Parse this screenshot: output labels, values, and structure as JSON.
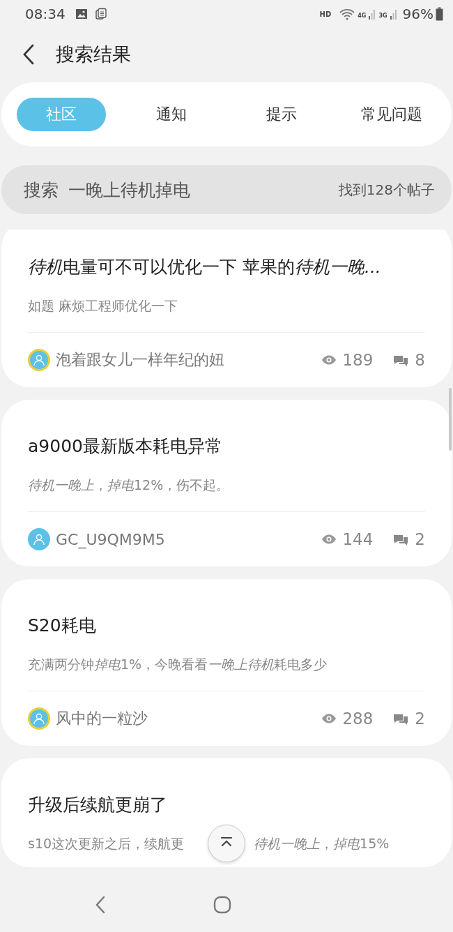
{
  "status_bar": {
    "time": "08:34",
    "network_label": "HD",
    "network_4g": "4G",
    "network_3g": "3G",
    "battery": "96%"
  },
  "header": {
    "title": "搜索结果"
  },
  "tabs": [
    {
      "label": "社区",
      "selected": true
    },
    {
      "label": "通知",
      "selected": false
    },
    {
      "label": "提示",
      "selected": false
    },
    {
      "label": "常见问题",
      "selected": false
    }
  ],
  "search": {
    "label": "搜索",
    "query": "一晚上待机掉电",
    "result_count": "找到128个帖子"
  },
  "posts": [
    {
      "title": [
        {
          "text": "待机",
          "italic": true
        },
        {
          "text": "电量可不可以优化一下 苹果的",
          "italic": false
        },
        {
          "text": "待机一晚...",
          "italic": true
        }
      ],
      "snippet": [
        [
          {
            "text": "如题 麻烦工程师优化一下",
            "italic": false
          }
        ]
      ],
      "author": "泡着跟女儿一样年纪的妞",
      "avatar_ring": true,
      "views": "189",
      "comments": "8"
    },
    {
      "title": [
        {
          "text": "a9000最新版本耗电异常",
          "italic": false
        }
      ],
      "snippet": [
        [
          {
            "text": "待机一晚上",
            "italic": true
          },
          {
            "text": "，",
            "italic": false
          },
          {
            "text": "掉电",
            "italic": true
          },
          {
            "text": "12%，伤不起。",
            "italic": false
          }
        ]
      ],
      "author": "GC_U9QM9M5",
      "avatar_ring": false,
      "views": "144",
      "comments": "2"
    },
    {
      "title": [
        {
          "text": "S20耗电",
          "italic": false
        }
      ],
      "snippet": [
        [
          {
            "text": "充满两分钟",
            "italic": false
          },
          {
            "text": "掉电",
            "italic": true
          },
          {
            "text": "1%，今晚看看",
            "italic": false
          },
          {
            "text": "一晚上待机",
            "italic": true
          },
          {
            "text": "耗电多少",
            "italic": false
          }
        ]
      ],
      "author": "风中的一粒沙",
      "avatar_ring": true,
      "views": "288",
      "comments": "2"
    },
    {
      "title": [
        {
          "text": "升级后续航更崩了",
          "italic": false
        }
      ],
      "snippet": [
        [
          {
            "text": "s10这次更新之后，续航更",
            "italic": false
          }
        ],
        [
          {
            "text": "待机一晚上",
            "italic": true
          },
          {
            "text": "，",
            "italic": false
          },
          {
            "text": "掉电",
            "italic": true
          },
          {
            "text": "15%",
            "italic": false
          }
        ]
      ]
    }
  ]
}
